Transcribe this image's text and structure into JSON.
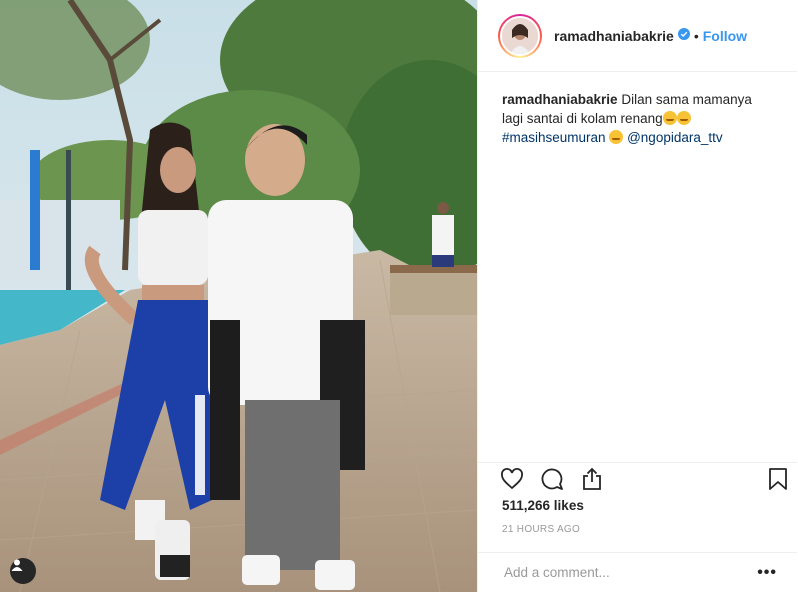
{
  "post": {
    "username": "ramadhaniabakrie",
    "verified": true,
    "separator": "•",
    "follow_label": "Follow",
    "caption": {
      "username": "ramadhaniabakrie",
      "text": "Dilan sama mamanya lagi santai di kolam renang",
      "hashtag": "#masihseumuran",
      "mention": "@ngopidara_ttv"
    },
    "likes": "511,266 likes",
    "time": "21 HOURS AGO",
    "comment_placeholder": "Add a comment...",
    "more_label": "•••"
  },
  "icons": [
    "heart-icon",
    "comment-icon",
    "share-icon",
    "bookmark-icon",
    "user-tag-icon",
    "verified-badge-icon"
  ],
  "colors": {
    "accent": "#3897f0",
    "text": "#262626",
    "muted": "#999999",
    "hashtag": "#003569"
  }
}
